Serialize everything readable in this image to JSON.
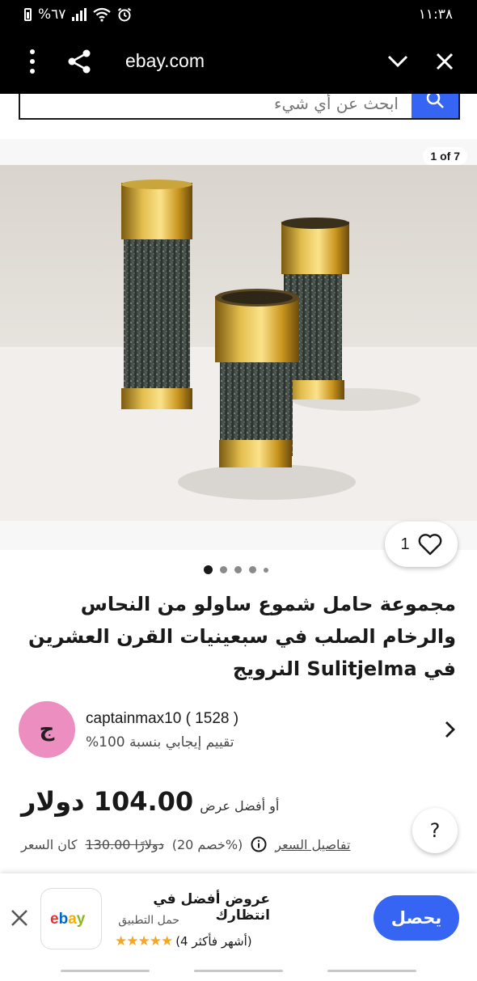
{
  "status_bar": {
    "battery": "%٦٧",
    "time": "١١:٣٨"
  },
  "browser": {
    "url": "ebay.com",
    "menu_icon": "more-vertical-icon",
    "share_icon": "share-icon",
    "collapse_icon": "chevron-down-icon",
    "close_icon": "close-icon"
  },
  "search": {
    "placeholder": "ابحث عن أي شيء"
  },
  "gallery": {
    "counter": "1 of 7",
    "watch_count": "1",
    "dots": 5
  },
  "listing": {
    "title": "مجموعة حامل شموع ساولو من النحاس والرخام الصلب في سبعينيات القرن العشرين في Sulitjelma النرويج"
  },
  "seller": {
    "avatar_letter": "ج",
    "name": "captainmax10 ( 1528 )",
    "feedback": "تقييم إيجابي بنسبة 100%"
  },
  "price": {
    "best_offer": "أو أفضل عرض",
    "amount": "104.00 دولار",
    "details_link": "تفاصيل السعر",
    "discount": "(خصم 20%)",
    "was_price": "130.00 دولارًا",
    "was_label": "كان السعر",
    "help": "?"
  },
  "app_banner": {
    "title": "عروض أفضل في انتظارك",
    "subtitle": "حمل التطبيق",
    "rating_text": "(4 أشهر فأكثر)",
    "rating": 5,
    "get_label": "يحصل",
    "app_logo": "ebay"
  },
  "colors": {
    "accent": "#3665f3",
    "avatar": "#ec8fc0",
    "star": "#f5a623"
  }
}
